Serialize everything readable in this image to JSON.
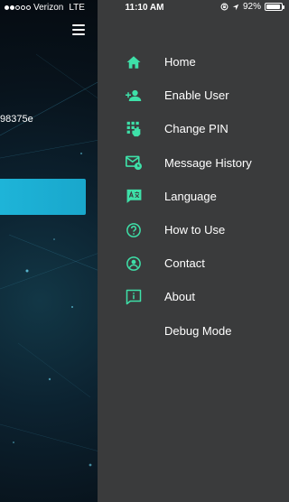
{
  "status_bar": {
    "carrier": "Verizon",
    "network": "LTE",
    "time": "11:10 AM",
    "battery": "92%",
    "battery_level": 0.92,
    "signal_bars_filled": 2,
    "signal_bars_total": 5
  },
  "background": {
    "id_fragment": "98375e"
  },
  "drawer": {
    "items": [
      {
        "label": "Home",
        "icon": "home-icon"
      },
      {
        "label": "Enable User",
        "icon": "add-user-icon"
      },
      {
        "label": "Change PIN",
        "icon": "keypad-icon"
      },
      {
        "label": "Message History",
        "icon": "message-history-icon"
      },
      {
        "label": "Language",
        "icon": "language-icon"
      },
      {
        "label": "How to Use",
        "icon": "help-icon"
      },
      {
        "label": "Contact",
        "icon": "contact-icon"
      },
      {
        "label": "About",
        "icon": "info-icon"
      },
      {
        "label": "Debug Mode",
        "icon": ""
      }
    ]
  },
  "colors": {
    "accent": "#3ee0a8",
    "drawer_bg": "#3a3b3c",
    "button_cyan": "#1eb4d8"
  }
}
